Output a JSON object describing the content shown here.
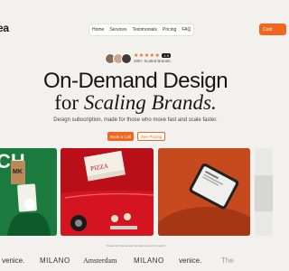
{
  "brand": {
    "logo_text": "ea"
  },
  "nav": {
    "items": [
      "Home",
      "Services",
      "Testimonials",
      "Pricing",
      "FAQ"
    ]
  },
  "header": {
    "cta": "Cont"
  },
  "rating": {
    "stars": "★★★★★",
    "score": "4.9",
    "clients": "300+ Scaled Brands"
  },
  "hero": {
    "title_line1": "On-Demand Design",
    "title_line2_prefix": "for ",
    "title_line2_italic": "Scaling Brands.",
    "subtitle": "Design subscription, made for those who move fast and scale faster.",
    "book_call": "Book a Call",
    "see_pricing": "See Pricing"
  },
  "gallery": {
    "card1_text": "CH",
    "card1_sub": "MK",
    "card2_text": "PIZZA"
  },
  "trusted": {
    "text": "Trusted by brands and founders around the world"
  },
  "logos": [
    "venice.",
    "MILANO",
    "Amsterdam",
    "MILANO",
    "venice.",
    "The"
  ],
  "colors": {
    "accent": "#f0651f",
    "background": "#f2f1ee",
    "red": "#b80f18",
    "green": "#1b7a3e"
  }
}
